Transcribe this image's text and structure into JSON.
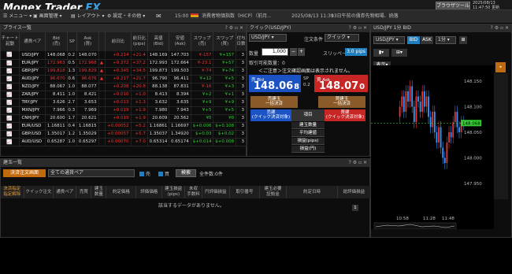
{
  "header": {
    "logo_main": "Monex Trader ",
    "logo_fx": "FX",
    "menu": [
      "メニュー",
      "画面管理",
      "レイアウト",
      "設定・その他"
    ],
    "ticker_time": "15:00",
    "ticker_text": "消費者物価指数（HICP）（前月...",
    "ticker_time2": "2025/08/13 11:39",
    "ticker_text2": "13日午前の債券先物相場、続落",
    "browser_button": "ブラウザツール",
    "date": "2025/08/13",
    "time": "11:47:50",
    "update": "更新"
  },
  "price_panel": {
    "title": "プライス一覧",
    "headers": [
      "チャート\n起動",
      "通貨ペア",
      "Bid\n(売)",
      "SP",
      "Ask\n(買)",
      "",
      "前日比",
      "前日比\n(pips)",
      "高値\n(Bid)",
      "安値\n(Ask)",
      "スワップ\n(売)",
      "スワップ\n(買)",
      "付与\n日数"
    ],
    "rows": [
      {
        "pair": "USD/JPY",
        "bid": "148.068",
        "sp": "0.2",
        "ask": "148.070",
        "arrow": "",
        "chg": "+0.214",
        "pips": "+21.4",
        "high": "148.169",
        "low": "147.703",
        "sws": "¥-157",
        "swb": "¥+157",
        "days": "3",
        "dir": "up"
      },
      {
        "pair": "EUR/JPY",
        "bid": "172.963",
        "sp": "0.5",
        "ask": "172.968",
        "arrow": "▲",
        "chg": "+0.372",
        "pips": "+37.2",
        "high": "172.993",
        "low": "172.664",
        "sws": "¥-23.1",
        "swb": "¥+57",
        "days": "3",
        "dir": "up"
      },
      {
        "pair": "GBP/JPY",
        "bid": "199.818",
        "sp": "1.3",
        "ask": "199.829",
        "arrow": "▲",
        "chg": "+0.345",
        "pips": "+34.5",
        "high": "199.873",
        "low": "199.503",
        "sws": "¥-74",
        "swb": "¥+74",
        "days": "3",
        "dir": "up"
      },
      {
        "pair": "AUD/JPY",
        "bid": "96.670",
        "sp": "0.6",
        "ask": "96.676",
        "arrow": "▲",
        "chg": "+0.217",
        "pips": "+21.7",
        "high": "96.790",
        "low": "96.411",
        "sws": "¥+12",
        "swb": "¥+5",
        "days": "3",
        "dir": "up"
      },
      {
        "pair": "NZD/JPY",
        "bid": "88.067",
        "sp": "1.0",
        "ask": "88.077",
        "arrow": "",
        "chg": "+0.208",
        "pips": "+20.8",
        "high": "88.138",
        "low": "87.831",
        "sws": "¥-16",
        "swb": "¥+3",
        "days": "3",
        "dir": "up"
      },
      {
        "pair": "ZAR/JPY",
        "bid": "8.411",
        "sp": "1.0",
        "ask": "8.421",
        "arrow": "",
        "chg": "+0.010",
        "pips": "+1.0",
        "high": "8.413",
        "low": "8.394",
        "sws": "¥+2",
        "swb": "¥+1",
        "days": "3",
        "dir": "up"
      },
      {
        "pair": "TRY/JPY",
        "bid": "3.626",
        "sp": "2.7",
        "ask": "3.653",
        "arrow": "",
        "chg": "+0.013",
        "pips": "+1.3",
        "high": "3.632",
        "low": "3.635",
        "sws": "¥+9",
        "swb": "¥+9",
        "days": "3",
        "dir": "wht"
      },
      {
        "pair": "MXN/JPY",
        "bid": "7.966",
        "sp": "0.3",
        "ask": "7.969",
        "arrow": "",
        "chg": "+0.019",
        "pips": "+1.9",
        "high": "7.980",
        "low": "7.943",
        "sws": "¥+5",
        "swb": "¥+5",
        "days": "3",
        "dir": "wht"
      },
      {
        "pair": "CNH/JPY",
        "bid": "20.600",
        "sp": "1.7",
        "ask": "20.621",
        "arrow": "",
        "chg": "+0.019",
        "pips": "+1.9",
        "high": "20.609",
        "low": "20.562",
        "sws": "¥0",
        "swb": "¥0",
        "days": "3",
        "dir": "wht"
      },
      {
        "pair": "EUR/USD",
        "bid": "1.16811",
        "sp": "0.4",
        "ask": "1.16815",
        "arrow": "",
        "chg": "+0.00052",
        "pips": "+5.2",
        "high": "1.16861",
        "low": "1.16697",
        "sws": "$+0.006",
        "swb": "$+0.108",
        "days": "3",
        "dir": "wht"
      },
      {
        "pair": "GBP/USD",
        "bid": "1.35017",
        "sp": "1.2",
        "ask": "1.35029",
        "arrow": "",
        "chg": "+0.00057",
        "pips": "+5.7",
        "high": "1.35037",
        "low": "1.34920",
        "sws": "$+0.03",
        "swb": "$+0.02",
        "days": "3",
        "dir": "wht"
      },
      {
        "pair": "AUD/USD",
        "bid": "0.65287",
        "sp": "1.0",
        "ask": "0.65297",
        "arrow": "",
        "chg": "+0.00070",
        "pips": "+7.0",
        "high": "0.65314",
        "low": "0.65174",
        "sws": "$+0.014",
        "swb": "$+0.008",
        "days": "3",
        "dir": "wht"
      }
    ]
  },
  "quick": {
    "title": "クイック(USD/JPY)",
    "pair": "USD/JPY",
    "cond_label": "注文条件",
    "cond_value": "クイック",
    "qty_label": "数量",
    "qty_value": "1,000",
    "slip_label": "スリッページ",
    "slip_value": "3.0 pips",
    "max_label": "取引可能数量：0",
    "notice": "＜ご注意＞注文確認画面は表示されません。",
    "sell_label": "売 Bid",
    "sell_big": "148.06",
    "sell_small": "8",
    "sp_label": "SP",
    "sp_value": "0.2",
    "buy_label": "買 Ask",
    "buy_big": "148.07",
    "buy_small": "0",
    "sell_all": "売建玉\n一括決済",
    "buy_all": "買建玉\n一括決済",
    "sell_pos": "売建\n(クイック決済対象)",
    "item": "項目",
    "buy_pos": "買建\n(クイック決済対象)",
    "rows": [
      "建玉数量",
      "平均建値",
      "損益(pips)",
      "損益(円)"
    ]
  },
  "chart": {
    "title": "USD/JPY 1分 BID",
    "pair": "USD/JPY",
    "bid": "BID",
    "ask": "ASK",
    "interval": "1分",
    "display": "表示",
    "ytick": [
      "148.150",
      "148.100",
      "148.050",
      "148.000",
      "147.950"
    ],
    "current": "148.068",
    "xtick": [
      "10:58",
      "11:28",
      "11:48"
    ]
  },
  "bottom": {
    "title": "建玉一覧",
    "tab1": "決済注文画面",
    "filter_placeholder": "全ての通貨ペア",
    "sell_chk": "売",
    "buy_chk": "買",
    "search": "検索",
    "count": "全件数:0件",
    "headers": [
      "決済指定\n指定解除",
      "クイック注文",
      "通貨ペア",
      "売買",
      "建玉\n数量",
      "約定価格",
      "評価価格",
      "建玉損益\n(pips)",
      "未収\n手数料",
      "円評価損益",
      "取引番号",
      "建玉必要\n証拠金",
      "約定日時",
      "総評価損益"
    ],
    "empty": "該当するデータがありません。",
    "page": "1"
  }
}
